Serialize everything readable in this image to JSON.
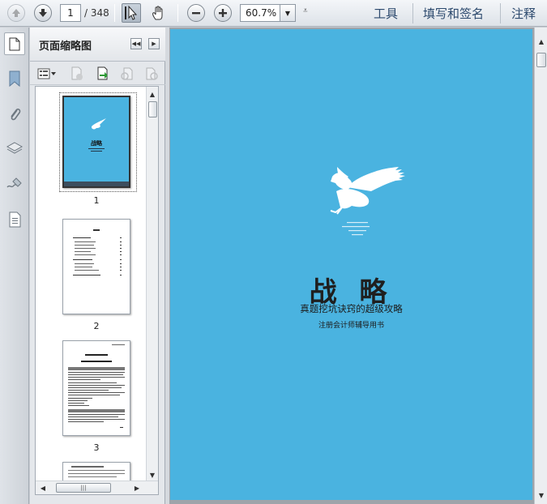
{
  "toolbar": {
    "page_current": "1",
    "page_total": "/ 348",
    "zoom": "60.7%",
    "tools_label": "工具",
    "fill_sign_label": "填写和签名",
    "comment_label": "注释"
  },
  "panel": {
    "title": "页面缩略图",
    "thumbnails": [
      {
        "label": "1"
      },
      {
        "label": "2"
      },
      {
        "label": "3"
      }
    ],
    "thumb1_title": "战略"
  },
  "document": {
    "title": "战 略",
    "subtitle": "真题挖坑诀窍的超级攻略",
    "note": "注册会计师辅导用书",
    "background_color": "#4ab3e0"
  },
  "colors": {
    "accent_link": "#2d4a6e",
    "page_blue": "#4ab3e0"
  }
}
